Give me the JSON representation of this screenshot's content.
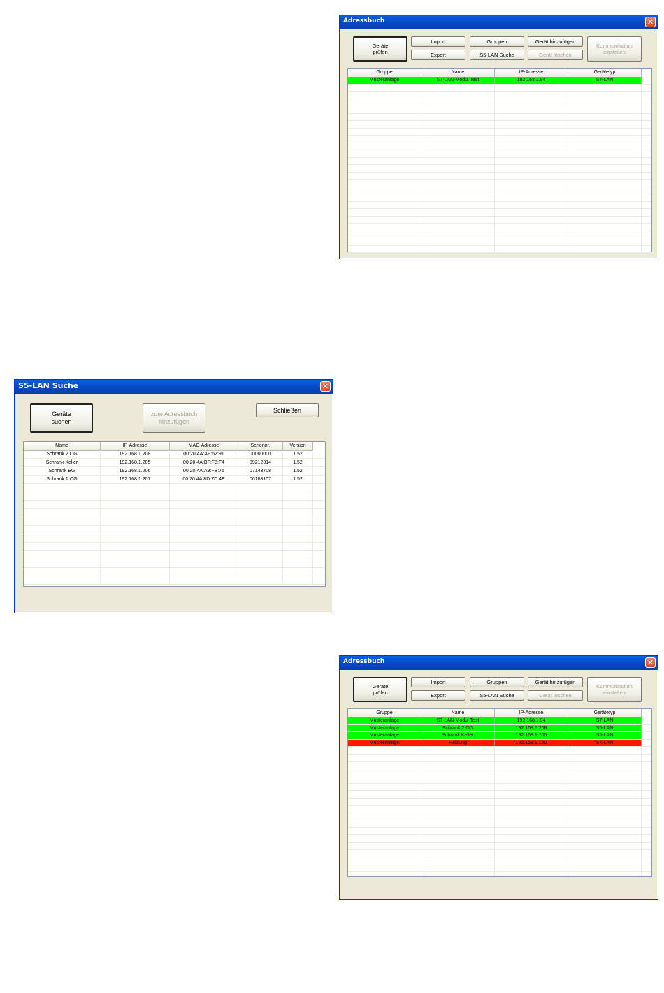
{
  "window1": {
    "title": "Adressbuch",
    "buttons": {
      "check": "Geräte\nprüfen",
      "import": "Import",
      "export": "Export",
      "groups": "Gruppen",
      "s5lan": "S5-LAN Suche",
      "add_device": "Gerät hinzufügen",
      "delete_device": "Gerät löschen",
      "communication": "Kommunikation\neinstellen"
    },
    "columns": [
      "Gruppe",
      "Name",
      "IP-Adresse",
      "Gerätetyp"
    ],
    "rows": [
      {
        "status": "green",
        "cells": [
          "Musteranlage",
          "S7-LAN-Modul Test",
          "192.168.1.94",
          "S7-LAN"
        ]
      }
    ]
  },
  "window2": {
    "title": "S5-LAN Suche",
    "buttons": {
      "search": "Geräte\nsuchen",
      "add_to_addressbook": "zum Adressbuch\nhinzufügen",
      "close": "Schließen"
    },
    "columns": [
      "Name",
      "IP-Adresse",
      "MAC-Adresse",
      "Seriennr.",
      "Version"
    ],
    "rows": [
      {
        "cells": [
          "Schrank 2.OG",
          "192.168.1.208",
          "00:20:4A:AF:62:91",
          "00000000",
          "1.52"
        ]
      },
      {
        "cells": [
          "Schrank Keller",
          "192.168.1.205",
          "00:20:4A:BF:F8:F4",
          "09212314",
          "1.52"
        ]
      },
      {
        "cells": [
          "Schrank EG",
          "192.168.1.206",
          "00:20:4A:A9:FB:75",
          "07143708",
          "1.52"
        ]
      },
      {
        "cells": [
          "Schrank 1.OG",
          "192.168.1.207",
          "00:20:4A:8D:7D:4E",
          "06188107",
          "1.52"
        ]
      }
    ]
  },
  "window3": {
    "title": "Adressbuch",
    "buttons": {
      "check": "Geräte\nprüfen",
      "import": "Import",
      "export": "Export",
      "groups": "Gruppen",
      "s5lan": "S5-LAN Suche",
      "add_device": "Gerät hinzufügen",
      "delete_device": "Gerät löschen",
      "communication": "Kommunikation\neinstellen"
    },
    "columns": [
      "Gruppe",
      "Name",
      "IP-Adresse",
      "Gerätetyp"
    ],
    "rows": [
      {
        "status": "green",
        "cells": [
          "Musteranlage",
          "S7-LAN-Modul Test",
          "192.168.1.94",
          "S7-LAN"
        ]
      },
      {
        "status": "green",
        "cells": [
          "Musteranlage",
          "Schrank 2.OG",
          "192.168.1.208",
          "S5-LAN"
        ]
      },
      {
        "status": "green",
        "cells": [
          "Musteranlage",
          "Schrank Keller",
          "192.168.1.205",
          "S5-LAN"
        ]
      },
      {
        "status": "red",
        "cells": [
          "Musteranlage",
          "Heizung",
          "192.168.1.120",
          "S7-LAN"
        ]
      }
    ]
  },
  "icons": {
    "close": "close-icon"
  },
  "colors": {
    "ok": "#00ff00",
    "error": "#ff1a00",
    "titlebar": "#0847c2"
  }
}
